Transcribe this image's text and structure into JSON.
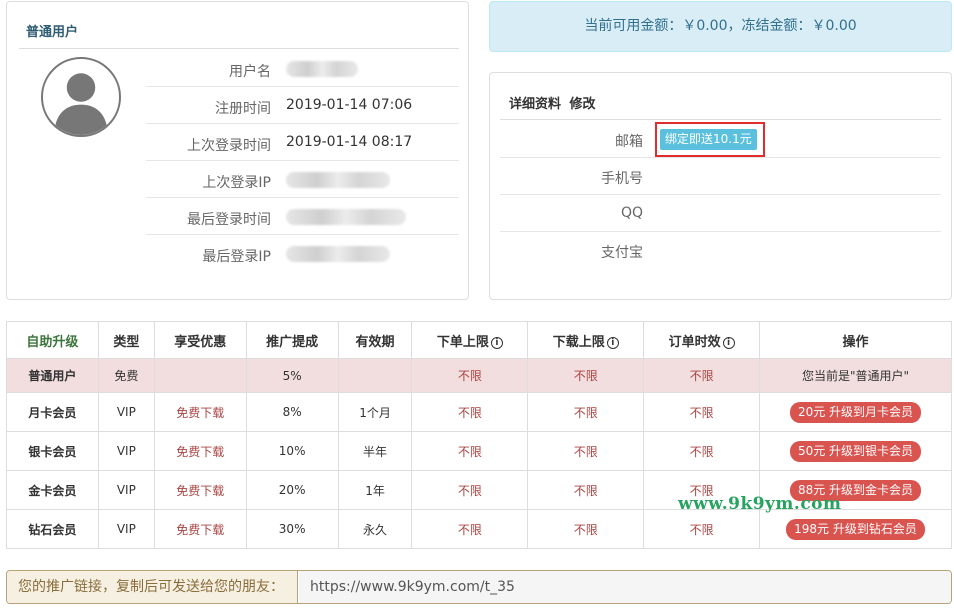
{
  "profile": {
    "title": "普通用户",
    "rows": [
      {
        "label": "用户名",
        "value": null
      },
      {
        "label": "注册时间",
        "value": "2019-01-14 07:06"
      },
      {
        "label": "上次登录时间",
        "value": "2019-01-14 08:17"
      },
      {
        "label": "上次登录IP",
        "value": null
      },
      {
        "label": "最后登录时间",
        "value": null
      },
      {
        "label": "最后登录IP",
        "value": null
      }
    ]
  },
  "balance": {
    "text": "当前可用金额：￥0.00，冻结金额：￥0.00"
  },
  "detail": {
    "title": "详细资料",
    "edit_label": "修改",
    "rows": [
      {
        "label": "邮箱"
      },
      {
        "label": "手机号"
      },
      {
        "label": "QQ"
      },
      {
        "label": "支付宝"
      }
    ],
    "bind_email_label": "绑定即送10.1元"
  },
  "upgrade_table": {
    "headers": [
      "自助升级",
      "类型",
      "享受优惠",
      "推广提成",
      "有效期",
      "下单上限",
      "下载上限",
      "订单时效",
      "操作"
    ],
    "info_icon": "ⓘ",
    "rows": [
      {
        "level": "普通用户",
        "type": "免费",
        "benefit": "",
        "commission": "5%",
        "validity": "",
        "order_limit": "不限",
        "download_limit": "不限",
        "order_time": "不限",
        "action": "您当前是\"普通用户\""
      },
      {
        "level": "月卡会员",
        "type": "VIP",
        "benefit": "免费下载",
        "commission": "8%",
        "validity": "1个月",
        "order_limit": "不限",
        "download_limit": "不限",
        "order_time": "不限",
        "action": "20元 升级到月卡会员"
      },
      {
        "level": "银卡会员",
        "type": "VIP",
        "benefit": "免费下载",
        "commission": "10%",
        "validity": "半年",
        "order_limit": "不限",
        "download_limit": "不限",
        "order_time": "不限",
        "action": "50元 升级到银卡会员"
      },
      {
        "level": "金卡会员",
        "type": "VIP",
        "benefit": "免费下载",
        "commission": "20%",
        "validity": "1年",
        "order_limit": "不限",
        "download_limit": "不限",
        "order_time": "不限",
        "action": "88元 升级到金卡会员"
      },
      {
        "level": "钻石会员",
        "type": "VIP",
        "benefit": "免费下载",
        "commission": "30%",
        "validity": "永久",
        "order_limit": "不限",
        "download_limit": "不限",
        "order_time": "不限",
        "action": "198元 升级到钻石会员"
      }
    ]
  },
  "watermark": "www.9k9ym.com",
  "referral": {
    "label": "您的推广链接，复制后可发送给您的朋友：",
    "url": "https://www.9k9ym.com/t_35"
  },
  "colors": {
    "panel_border": "#dddddd",
    "balance_bg": "#d9edf7",
    "balance_text": "#31708f",
    "current_row_bg": "#f2dede",
    "unlimited_text": "#a94442",
    "upgrade_button": "#d9534f",
    "bind_button": "#5bc0de",
    "highlight_box": "#e02d2d",
    "watermark": "#27a360"
  }
}
